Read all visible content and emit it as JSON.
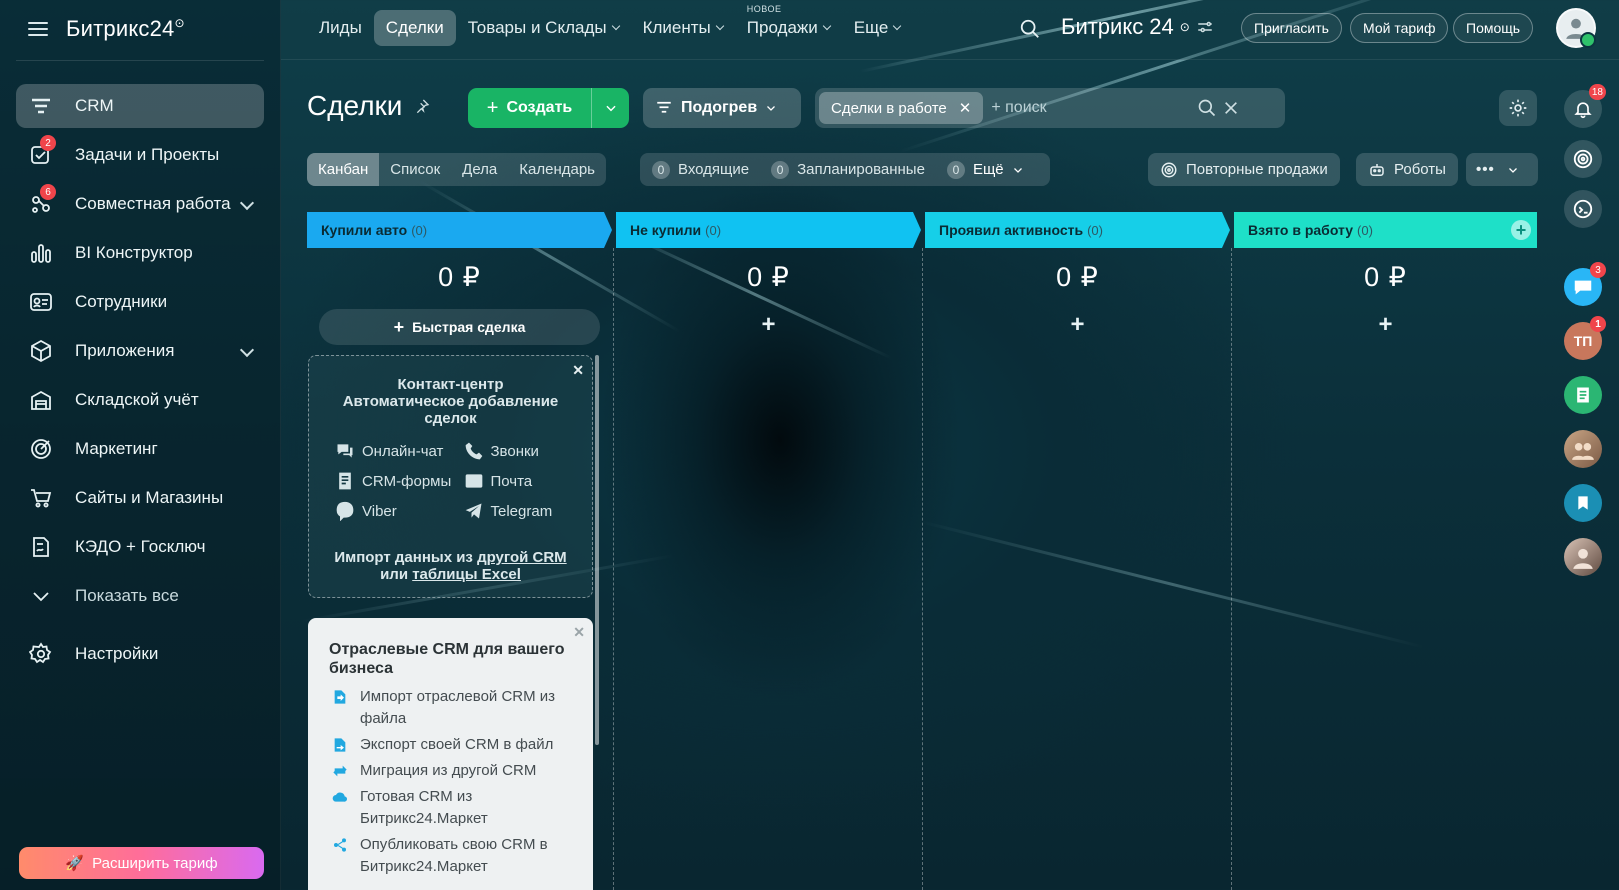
{
  "app": {
    "brand": "Битрикс24",
    "brand_suffix": "⊙"
  },
  "sidebar": {
    "items": [
      {
        "label": "CRM",
        "icon": "crm-filter-icon",
        "active": true
      },
      {
        "label": "Задачи и Проекты",
        "icon": "tasks-check-icon",
        "badge": "2"
      },
      {
        "label": "Совместная работа",
        "icon": "collaboration-icon",
        "badge": "6",
        "expandable": true
      },
      {
        "label": "BI Конструктор",
        "icon": "bar-chart-icon"
      },
      {
        "label": "Сотрудники",
        "icon": "employees-card-icon"
      },
      {
        "label": "Приложения",
        "icon": "apps-cube-icon",
        "expandable": true
      },
      {
        "label": "Складской учёт",
        "icon": "warehouse-icon"
      },
      {
        "label": "Маркетинг",
        "icon": "marketing-target-icon"
      },
      {
        "label": "Сайты и Магазины",
        "icon": "cart-icon"
      },
      {
        "label": "КЭДО + Госключ",
        "icon": "document-sign-icon"
      },
      {
        "label": "Показать все",
        "icon": "chevron-down-icon"
      },
      {
        "label": "Настройки",
        "icon": "gear-icon"
      }
    ],
    "upgrade_label": "Расширить тариф"
  },
  "topnav": {
    "items": [
      {
        "label": "Лиды"
      },
      {
        "label": "Сделки",
        "active": true
      },
      {
        "label": "Товары и Склады",
        "dropdown": true
      },
      {
        "label": "Клиенты",
        "dropdown": true
      },
      {
        "label": "Продажи",
        "dropdown": true,
        "tag": "НОВОЕ"
      },
      {
        "label": "Еще",
        "dropdown": true
      }
    ],
    "brand": "Битрикс 24",
    "invite": "Пригласить",
    "tariff": "Мой тариф",
    "help": "Помощь"
  },
  "header": {
    "title": "Сделки",
    "create_label": "Создать",
    "funnel_label": "Подогрев",
    "filter_chip": "Сделки в работе",
    "search_placeholder": "+ поиск"
  },
  "views": {
    "tabs": [
      "Канбан",
      "Список",
      "Дела",
      "Календарь"
    ],
    "active": "Канбан",
    "counters": [
      {
        "count": "0",
        "label": "Входящие"
      },
      {
        "count": "0",
        "label": "Запланированные"
      },
      {
        "count": "0",
        "label": "Ещё"
      }
    ],
    "repeat_sales": "Повторные продажи",
    "robots": "Роботы"
  },
  "kanban": {
    "columns": [
      {
        "title": "Купили авто",
        "count": "(0)",
        "sum": "0 ₽",
        "color": "#1aa9f0"
      },
      {
        "title": "Не купили",
        "count": "(0)",
        "sum": "0 ₽",
        "color": "#10c2f2"
      },
      {
        "title": "Проявил активность",
        "count": "(0)",
        "sum": "0 ₽",
        "color": "#16cfe8"
      },
      {
        "title": "Взято в работу",
        "count": "(0)",
        "sum": "0 ₽",
        "color": "#1ee0c8"
      }
    ],
    "quick_deal": "Быстрая сделка",
    "contact_center": {
      "title_line1": "Контакт-центр",
      "title_line2": "Автоматическое добавление",
      "title_line3": "сделок",
      "channels": [
        "Онлайн-чат",
        "Звонки",
        "CRM-формы",
        "Почта",
        "Viber",
        "Telegram"
      ],
      "import_line1_prefix": "Импорт данных из ",
      "import_line1_link": "другой CRM",
      "import_line2_prefix": "или ",
      "import_line2_link": "таблицы Excel"
    },
    "industry": {
      "title": "Отраслевые CRM для вашего бизнеса",
      "items": [
        "Импорт отраслевой CRM из файла",
        "Экспорт своей CRM в файл",
        "Миграция из другой CRM",
        "Готовая CRM из Битрикс24.Маркет",
        "Опубликовать свою CRM в Битрикс24.Маркет"
      ]
    }
  },
  "rail": {
    "notifications_badge": "18",
    "chat_badge": "3",
    "support_initials": "ТП",
    "support_badge": "1"
  },
  "colors": {
    "accent_green": "#19b465",
    "badge_red": "#f0454b",
    "link_blue": "#21a8e0"
  }
}
